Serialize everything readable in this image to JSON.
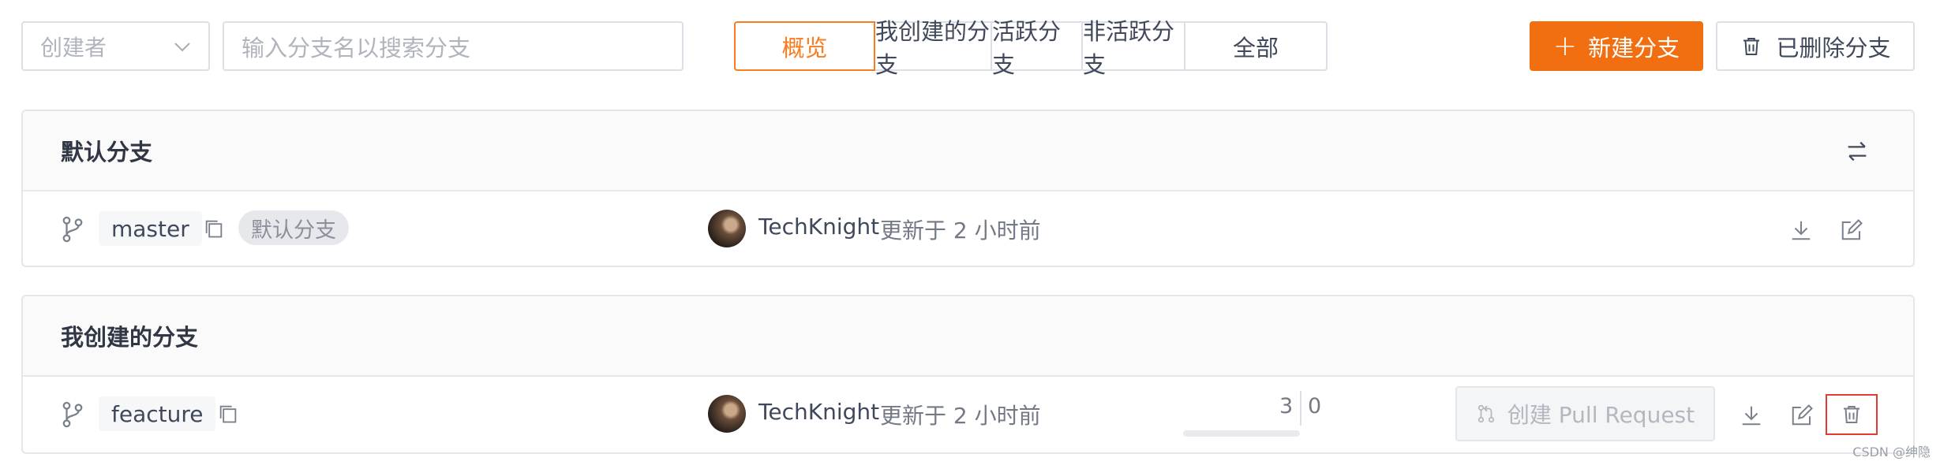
{
  "toolbar": {
    "creator_placeholder": "创建者",
    "search_placeholder": "输入分支名以搜索分支",
    "tabs": [
      "概览",
      "我创建的分支",
      "活跃分支",
      "非活跃分支",
      "全部"
    ],
    "active_tab": "概览",
    "new_branch_label": "新建分支",
    "deleted_branches_label": "已删除分支"
  },
  "colors": {
    "accent": "#f26f11",
    "active_tab": "#fa7c1e",
    "highlight": "#e53935"
  },
  "default_section": {
    "title": "默认分支",
    "branch": {
      "name": "master",
      "tag": "默认分支",
      "author": "TechKnight",
      "updated": "更新于 2 小时前"
    }
  },
  "my_section": {
    "title": "我创建的分支",
    "branch": {
      "name": "feacture",
      "author": "TechKnight",
      "updated": "更新于 2 小时前",
      "behind": "3",
      "ahead": "0",
      "pr_label": "创建 Pull Request"
    }
  },
  "watermark": "CSDN @绅隐"
}
